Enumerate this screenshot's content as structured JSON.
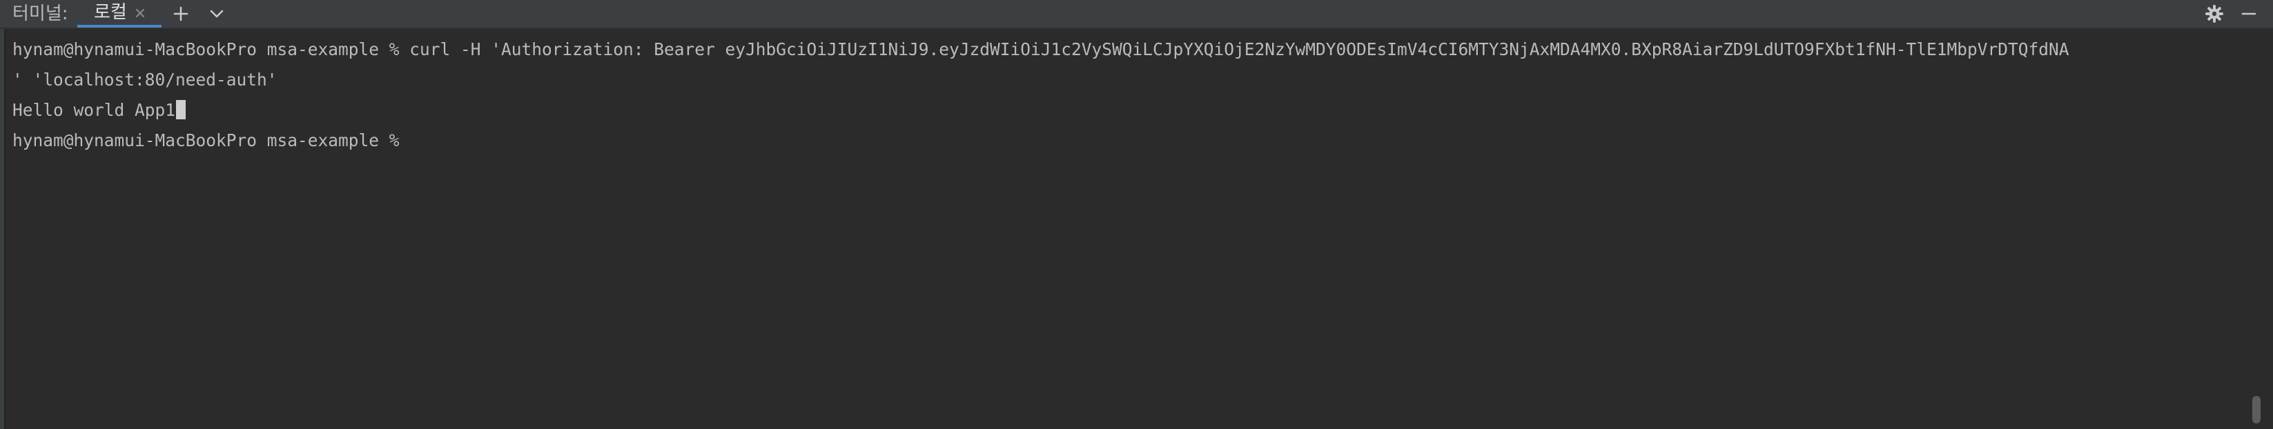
{
  "tool_window": {
    "title": "터미널:",
    "tabs": [
      {
        "label": "로컬",
        "active": true
      }
    ]
  },
  "terminal": {
    "lines": [
      "hynam@hynamui-MacBookPro msa-example % curl -H 'Authorization: Bearer eyJhbGciOiJIUzI1NiJ9.eyJzdWIiOiJ1c2VySWQiLCJpYXQiOjE2NzYwMDY0ODEsImV4cCI6MTY3NjAxMDA4MX0.BXpR8AiarZD9LdUTO9FXbt1fNH-TlE1MbpVrDTQfdNA",
      "' 'localhost:80/need-auth'",
      "Hello world App1",
      "hynam@hynamui-MacBookPro msa-example % "
    ]
  },
  "colors": {
    "background": "#2b2b2b",
    "tabbar": "#3c3f41",
    "text": "#bbbbbb",
    "accent": "#4a88c7"
  },
  "icons": {
    "tab_close": "close-icon",
    "new_tab": "plus-icon",
    "tab_dropdown": "chevron-down-icon",
    "settings": "gear-icon",
    "hide": "minimize-icon"
  }
}
